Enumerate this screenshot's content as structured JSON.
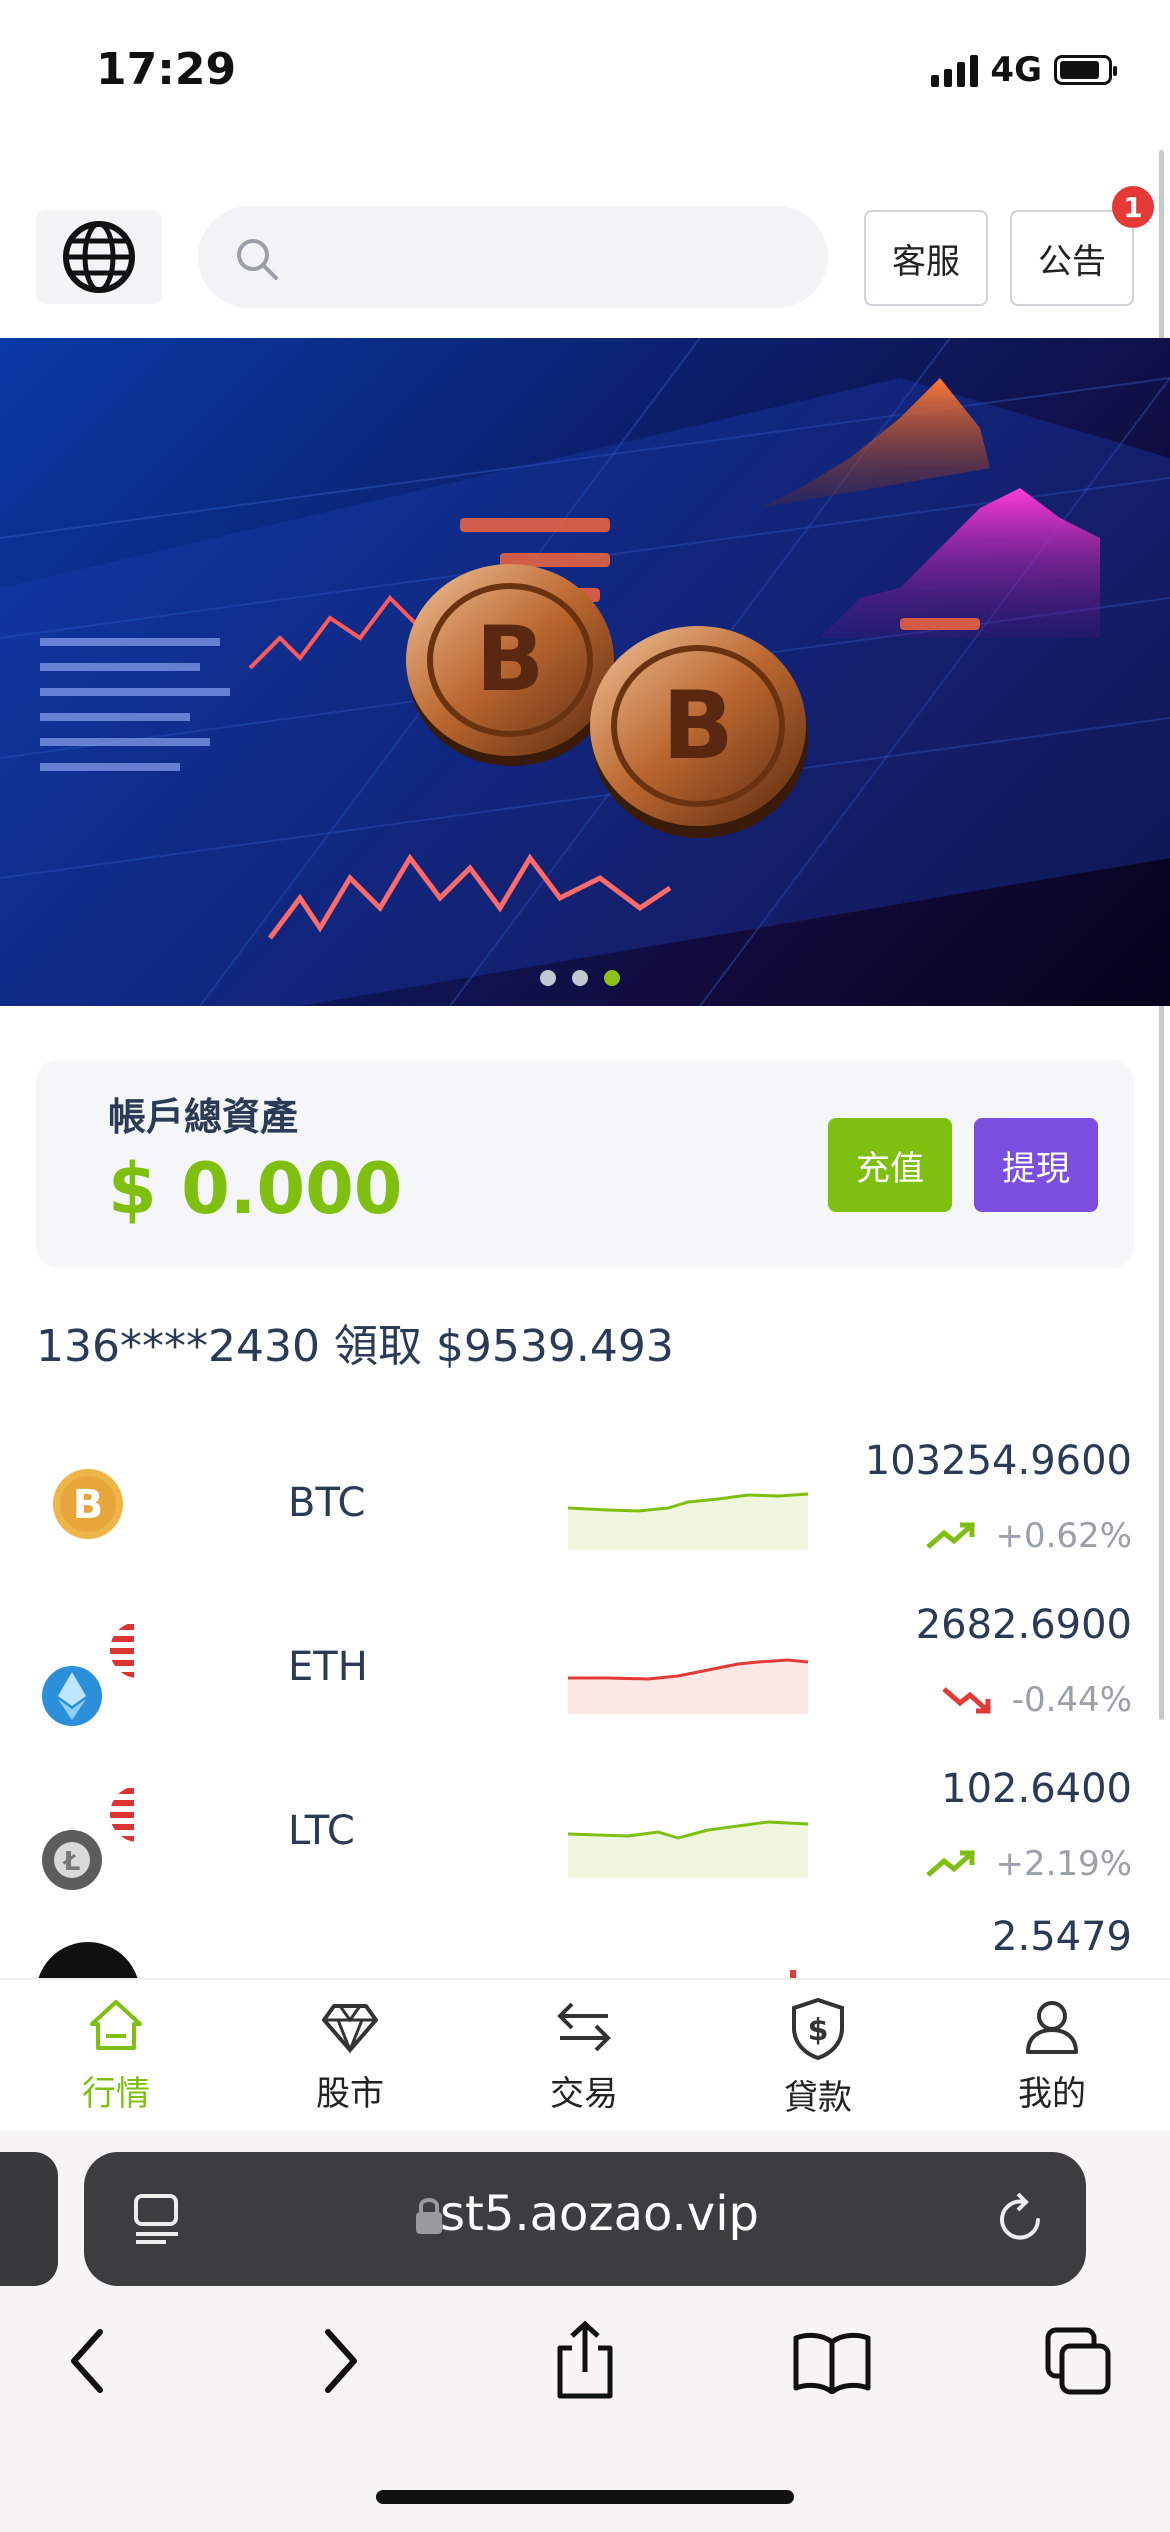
{
  "status_bar": {
    "time": "17:29",
    "network": "4G",
    "battery_level": 0.85
  },
  "header": {
    "search_placeholder": "",
    "service_label": "客服",
    "notice_label": "公告",
    "notice_badge": "1"
  },
  "banner": {
    "slide_count": 3,
    "active_slide": 3
  },
  "account": {
    "label": "帳戶總資產",
    "value": "$ 0.000",
    "deposit_label": "充值",
    "withdraw_label": "提現"
  },
  "ticker": "136****2430 領取 $9539.493",
  "coins": [
    {
      "symbol": "BTC",
      "price": "103254.9600",
      "change": "+0.62%",
      "trend": "up"
    },
    {
      "symbol": "ETH",
      "price": "2682.6900",
      "change": "-0.44%",
      "trend": "down"
    },
    {
      "symbol": "LTC",
      "price": "102.6400",
      "change": "+2.19%",
      "trend": "up"
    },
    {
      "symbol": "",
      "price": "2.5479",
      "change": "",
      "trend": "down"
    }
  ],
  "bottom_nav": [
    {
      "label": "行情",
      "icon": "home-icon",
      "active": true
    },
    {
      "label": "股市",
      "icon": "diamond-icon",
      "active": false
    },
    {
      "label": "交易",
      "icon": "swap-icon",
      "active": false
    },
    {
      "label": "貸款",
      "icon": "loan-shield-icon",
      "active": false
    },
    {
      "label": "我的",
      "icon": "user-icon",
      "active": false
    }
  ],
  "browser": {
    "url": "st5.aozao.vip"
  },
  "colors": {
    "accent_green": "#7fbf0f",
    "accent_purple": "#7b4ee0",
    "down_red": "#e53935"
  }
}
